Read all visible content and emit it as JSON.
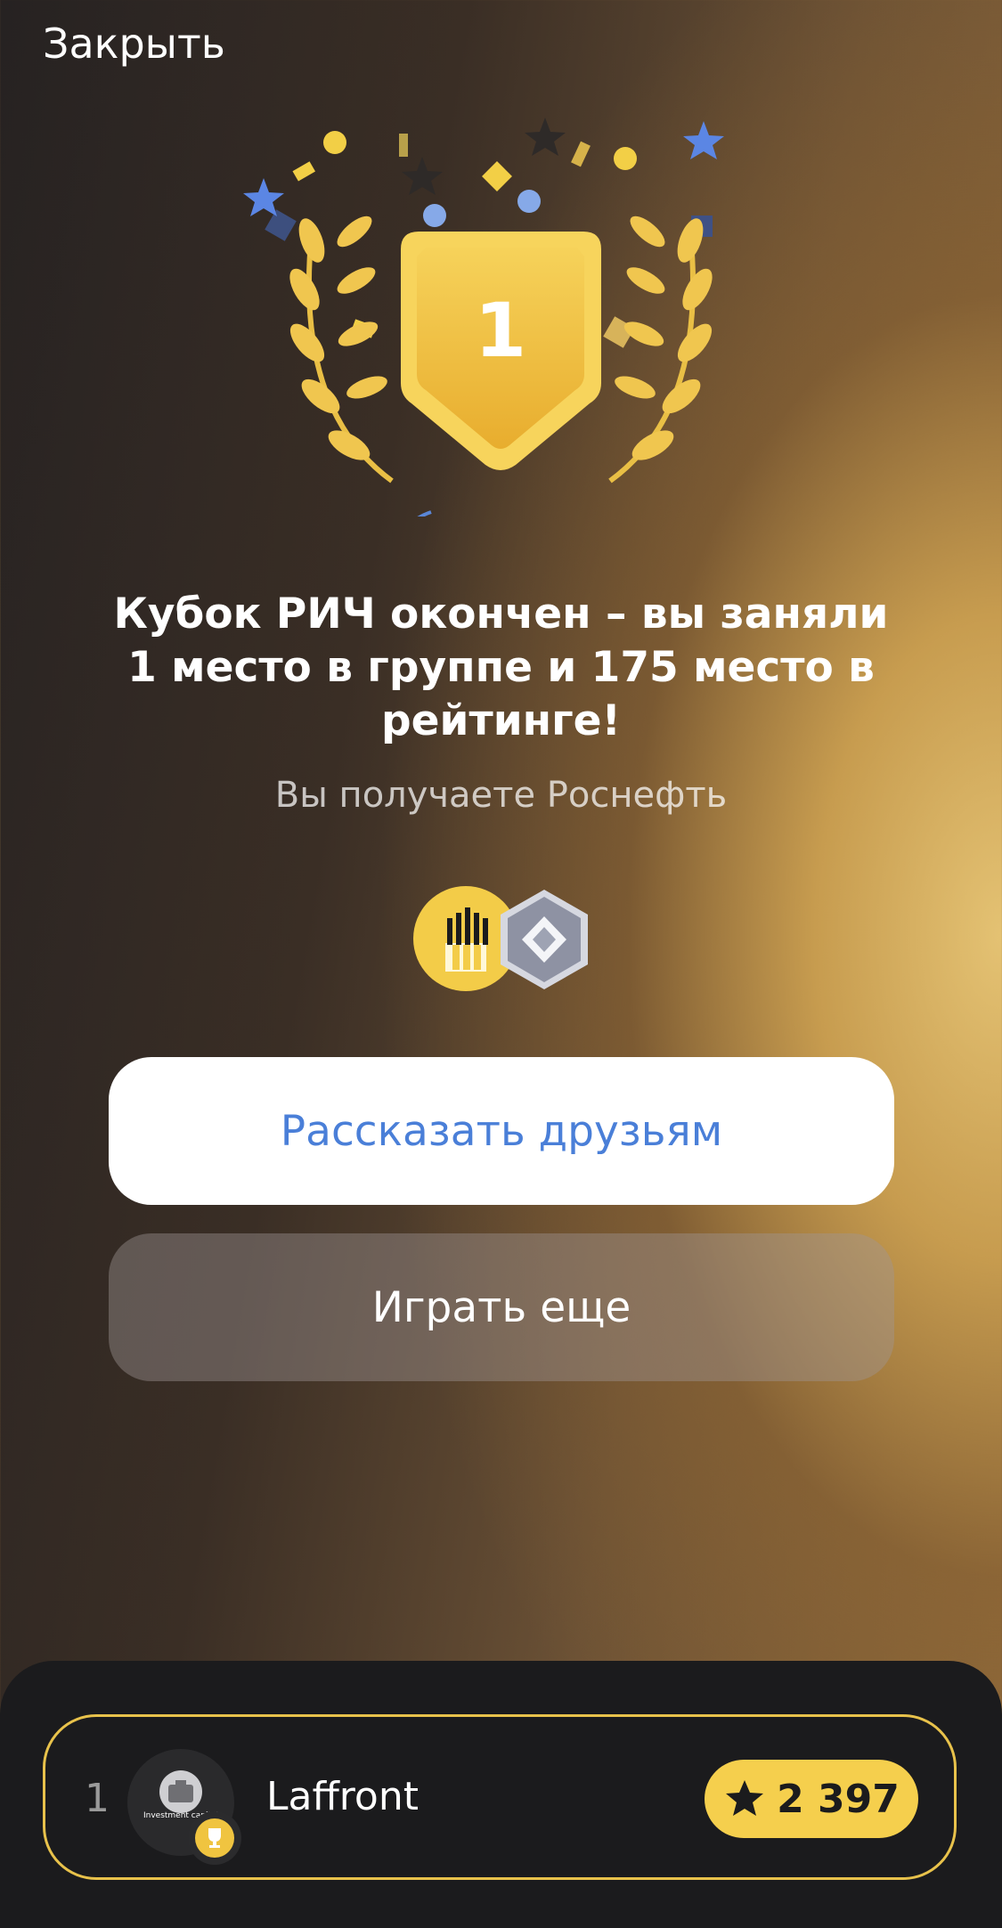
{
  "header": {
    "close_label": "Закрыть"
  },
  "hero": {
    "place_number": "1"
  },
  "result": {
    "title": "Кубок РИЧ окончен – вы заняли 1 место в группе и 175 место в рейтинге!",
    "subtitle": "Вы получаете Роснефть"
  },
  "rewards": [
    {
      "name": "rosneft-logo-icon",
      "color": "#f3cc48"
    },
    {
      "name": "silver-hexagon-badge-icon",
      "color": "#9ea3b3"
    }
  ],
  "buttons": {
    "share_label": "Рассказать друзьям",
    "play_again_label": "Играть еще"
  },
  "leaderboard": {
    "rows": [
      {
        "rank": "1",
        "username": "Laffront",
        "avatar_text": "Investment capital",
        "score": "2 397"
      }
    ]
  },
  "colors": {
    "accent_gold": "#f5cf4d",
    "link_blue": "#4a7fd8",
    "sheet_bg": "#1b1b1d"
  }
}
